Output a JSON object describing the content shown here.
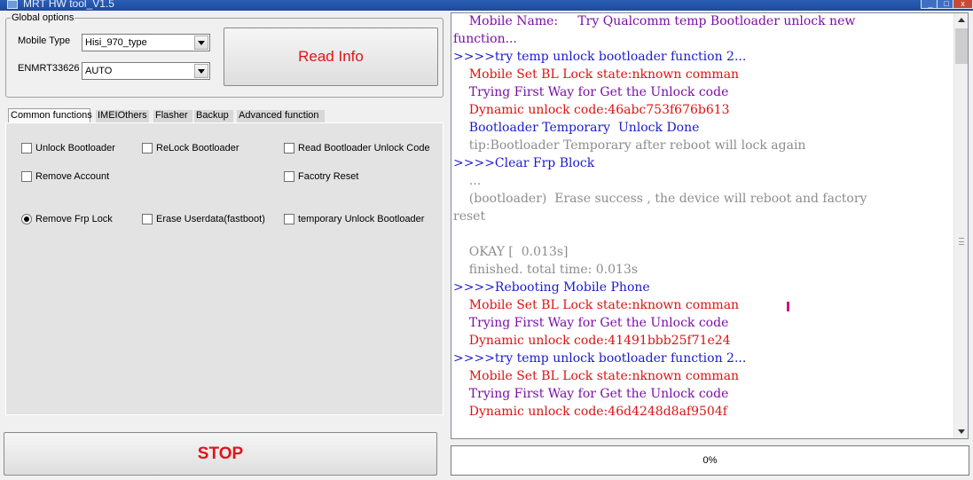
{
  "window": {
    "title": "MRT HW tool_V1.5",
    "controls": {
      "minimize": "_",
      "maximize": "□",
      "close": "x"
    }
  },
  "global_options": {
    "legend": "Global options",
    "mobile_type_label": "Mobile Type",
    "mobile_type_value": "Hisi_970_type",
    "enmrt_label": "ENMRT33626",
    "enmrt_value": "AUTO"
  },
  "buttons": {
    "read_info": "Read Info",
    "stop": "STOP"
  },
  "tabs": [
    {
      "label": "Common functions",
      "active": true
    },
    {
      "label": "IMEIOthers",
      "active": false
    },
    {
      "label": "Flasher",
      "active": false
    },
    {
      "label": "Backup",
      "active": false
    },
    {
      "label": "Advanced function",
      "active": false
    }
  ],
  "options": [
    {
      "label": "Unlock Bootloader",
      "kind": "checkbox",
      "checked": false
    },
    {
      "label": "ReLock Bootloader",
      "kind": "checkbox",
      "checked": false
    },
    {
      "label": "Read Bootloader Unlock Code",
      "kind": "checkbox",
      "checked": false
    },
    {
      "label": "Remove Account",
      "kind": "checkbox",
      "checked": false
    },
    {
      "label": "Facotry Reset",
      "kind": "checkbox",
      "checked": false
    },
    {
      "label": "Remove Frp Lock",
      "kind": "radio",
      "checked": true
    },
    {
      "label": "Erase Userdata(fastboot)",
      "kind": "checkbox",
      "checked": false
    },
    {
      "label": "temporary Unlock Bootloader",
      "kind": "checkbox",
      "checked": false
    }
  ],
  "log": [
    {
      "text": "    Mobile Name:     Try Qualcomm temp Bootloader unlock new",
      "color": "purple"
    },
    {
      "text": "function...",
      "color": "purple"
    },
    {
      "text": ">>>>try temp unlock bootloader function 2...",
      "color": "blue"
    },
    {
      "text": "    Mobile Set BL Lock state:nknown comman",
      "color": "red"
    },
    {
      "text": "    Trying First Way for Get the Unlock code",
      "color": "purple"
    },
    {
      "text": "    Dynamic unlock code:46abc753f676b613",
      "color": "red"
    },
    {
      "text": "    Bootloader Temporary  Unlock Done",
      "color": "blue"
    },
    {
      "text": "    tip:Bootloader Temporary after reboot will lock again",
      "color": "gray"
    },
    {
      "text": ">>>>Clear Frp Block",
      "color": "blue"
    },
    {
      "text": "    ...",
      "color": "gray"
    },
    {
      "text": "    (bootloader)  Erase success , the device will reboot and factory",
      "color": "gray"
    },
    {
      "text": "reset",
      "color": "gray"
    },
    {
      "text": "",
      "color": "gray"
    },
    {
      "text": "    OKAY [  0.013s]",
      "color": "gray"
    },
    {
      "text": "    finished. total time: 0.013s",
      "color": "gray"
    },
    {
      "text": ">>>>Rebooting Mobile Phone",
      "color": "blue"
    },
    {
      "text": "    Mobile Set BL Lock state:nknown comman",
      "color": "red"
    },
    {
      "text": "    Trying First Way for Get the Unlock code",
      "color": "purple"
    },
    {
      "text": "    Dynamic unlock code:41491bbb25f71e24",
      "color": "red"
    },
    {
      "text": ">>>>try temp unlock bootloader function 2...",
      "color": "blue"
    },
    {
      "text": "    Mobile Set BL Lock state:nknown comman",
      "color": "red"
    },
    {
      "text": "    Trying First Way for Get the Unlock code",
      "color": "purple"
    },
    {
      "text": "    Dynamic unlock code:46d4248d8af9504f",
      "color": "red"
    }
  ],
  "progress": {
    "label": "0%",
    "value": 0
  }
}
